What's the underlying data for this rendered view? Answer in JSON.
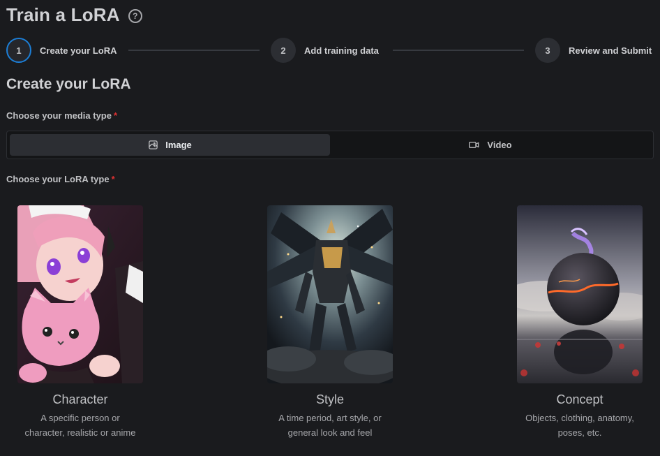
{
  "header": {
    "title": "Train a LoRA",
    "help_icon": "question-circle-icon"
  },
  "stepper": {
    "steps": [
      {
        "number": "1",
        "label": "Create your LoRA",
        "active": true
      },
      {
        "number": "2",
        "label": "Add training data",
        "active": false
      },
      {
        "number": "3",
        "label": "Review and Submit",
        "active": false
      }
    ]
  },
  "form": {
    "section_title": "Create your LoRA",
    "media_type": {
      "label": "Choose your media type",
      "required_mark": "*",
      "options": [
        {
          "label": "Image",
          "icon": "image-icon",
          "selected": true
        },
        {
          "label": "Video",
          "icon": "video-camera-icon",
          "selected": false
        }
      ]
    },
    "lora_type": {
      "label": "Choose your LoRA type",
      "required_mark": "*",
      "options": [
        {
          "title": "Character",
          "desc_line1": "A specific person or",
          "desc_line2": "character, realistic or anime"
        },
        {
          "title": "Style",
          "desc_line1": "A time period, art style, or",
          "desc_line2": "general look and feel"
        },
        {
          "title": "Concept",
          "desc_line1": "Objects, clothing, anatomy,",
          "desc_line2": "poses, etc."
        }
      ]
    }
  },
  "colors": {
    "accent": "#1c7ed6",
    "background": "#1a1b1e",
    "required": "#e03131"
  }
}
